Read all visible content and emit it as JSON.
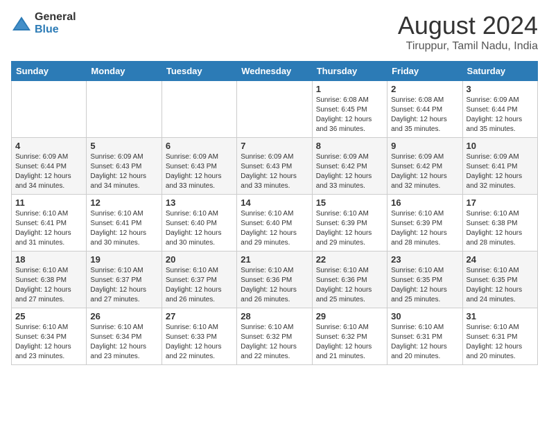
{
  "header": {
    "logo_general": "General",
    "logo_blue": "Blue",
    "month_title": "August 2024",
    "location": "Tiruppur, Tamil Nadu, India"
  },
  "days_of_week": [
    "Sunday",
    "Monday",
    "Tuesday",
    "Wednesday",
    "Thursday",
    "Friday",
    "Saturday"
  ],
  "weeks": [
    [
      {
        "day": "",
        "info": ""
      },
      {
        "day": "",
        "info": ""
      },
      {
        "day": "",
        "info": ""
      },
      {
        "day": "",
        "info": ""
      },
      {
        "day": "1",
        "info": "Sunrise: 6:08 AM\nSunset: 6:45 PM\nDaylight: 12 hours\nand 36 minutes."
      },
      {
        "day": "2",
        "info": "Sunrise: 6:08 AM\nSunset: 6:44 PM\nDaylight: 12 hours\nand 35 minutes."
      },
      {
        "day": "3",
        "info": "Sunrise: 6:09 AM\nSunset: 6:44 PM\nDaylight: 12 hours\nand 35 minutes."
      }
    ],
    [
      {
        "day": "4",
        "info": "Sunrise: 6:09 AM\nSunset: 6:44 PM\nDaylight: 12 hours\nand 34 minutes."
      },
      {
        "day": "5",
        "info": "Sunrise: 6:09 AM\nSunset: 6:43 PM\nDaylight: 12 hours\nand 34 minutes."
      },
      {
        "day": "6",
        "info": "Sunrise: 6:09 AM\nSunset: 6:43 PM\nDaylight: 12 hours\nand 33 minutes."
      },
      {
        "day": "7",
        "info": "Sunrise: 6:09 AM\nSunset: 6:43 PM\nDaylight: 12 hours\nand 33 minutes."
      },
      {
        "day": "8",
        "info": "Sunrise: 6:09 AM\nSunset: 6:42 PM\nDaylight: 12 hours\nand 33 minutes."
      },
      {
        "day": "9",
        "info": "Sunrise: 6:09 AM\nSunset: 6:42 PM\nDaylight: 12 hours\nand 32 minutes."
      },
      {
        "day": "10",
        "info": "Sunrise: 6:09 AM\nSunset: 6:41 PM\nDaylight: 12 hours\nand 32 minutes."
      }
    ],
    [
      {
        "day": "11",
        "info": "Sunrise: 6:10 AM\nSunset: 6:41 PM\nDaylight: 12 hours\nand 31 minutes."
      },
      {
        "day": "12",
        "info": "Sunrise: 6:10 AM\nSunset: 6:41 PM\nDaylight: 12 hours\nand 30 minutes."
      },
      {
        "day": "13",
        "info": "Sunrise: 6:10 AM\nSunset: 6:40 PM\nDaylight: 12 hours\nand 30 minutes."
      },
      {
        "day": "14",
        "info": "Sunrise: 6:10 AM\nSunset: 6:40 PM\nDaylight: 12 hours\nand 29 minutes."
      },
      {
        "day": "15",
        "info": "Sunrise: 6:10 AM\nSunset: 6:39 PM\nDaylight: 12 hours\nand 29 minutes."
      },
      {
        "day": "16",
        "info": "Sunrise: 6:10 AM\nSunset: 6:39 PM\nDaylight: 12 hours\nand 28 minutes."
      },
      {
        "day": "17",
        "info": "Sunrise: 6:10 AM\nSunset: 6:38 PM\nDaylight: 12 hours\nand 28 minutes."
      }
    ],
    [
      {
        "day": "18",
        "info": "Sunrise: 6:10 AM\nSunset: 6:38 PM\nDaylight: 12 hours\nand 27 minutes."
      },
      {
        "day": "19",
        "info": "Sunrise: 6:10 AM\nSunset: 6:37 PM\nDaylight: 12 hours\nand 27 minutes."
      },
      {
        "day": "20",
        "info": "Sunrise: 6:10 AM\nSunset: 6:37 PM\nDaylight: 12 hours\nand 26 minutes."
      },
      {
        "day": "21",
        "info": "Sunrise: 6:10 AM\nSunset: 6:36 PM\nDaylight: 12 hours\nand 26 minutes."
      },
      {
        "day": "22",
        "info": "Sunrise: 6:10 AM\nSunset: 6:36 PM\nDaylight: 12 hours\nand 25 minutes."
      },
      {
        "day": "23",
        "info": "Sunrise: 6:10 AM\nSunset: 6:35 PM\nDaylight: 12 hours\nand 25 minutes."
      },
      {
        "day": "24",
        "info": "Sunrise: 6:10 AM\nSunset: 6:35 PM\nDaylight: 12 hours\nand 24 minutes."
      }
    ],
    [
      {
        "day": "25",
        "info": "Sunrise: 6:10 AM\nSunset: 6:34 PM\nDaylight: 12 hours\nand 23 minutes."
      },
      {
        "day": "26",
        "info": "Sunrise: 6:10 AM\nSunset: 6:34 PM\nDaylight: 12 hours\nand 23 minutes."
      },
      {
        "day": "27",
        "info": "Sunrise: 6:10 AM\nSunset: 6:33 PM\nDaylight: 12 hours\nand 22 minutes."
      },
      {
        "day": "28",
        "info": "Sunrise: 6:10 AM\nSunset: 6:32 PM\nDaylight: 12 hours\nand 22 minutes."
      },
      {
        "day": "29",
        "info": "Sunrise: 6:10 AM\nSunset: 6:32 PM\nDaylight: 12 hours\nand 21 minutes."
      },
      {
        "day": "30",
        "info": "Sunrise: 6:10 AM\nSunset: 6:31 PM\nDaylight: 12 hours\nand 20 minutes."
      },
      {
        "day": "31",
        "info": "Sunrise: 6:10 AM\nSunset: 6:31 PM\nDaylight: 12 hours\nand 20 minutes."
      }
    ]
  ]
}
